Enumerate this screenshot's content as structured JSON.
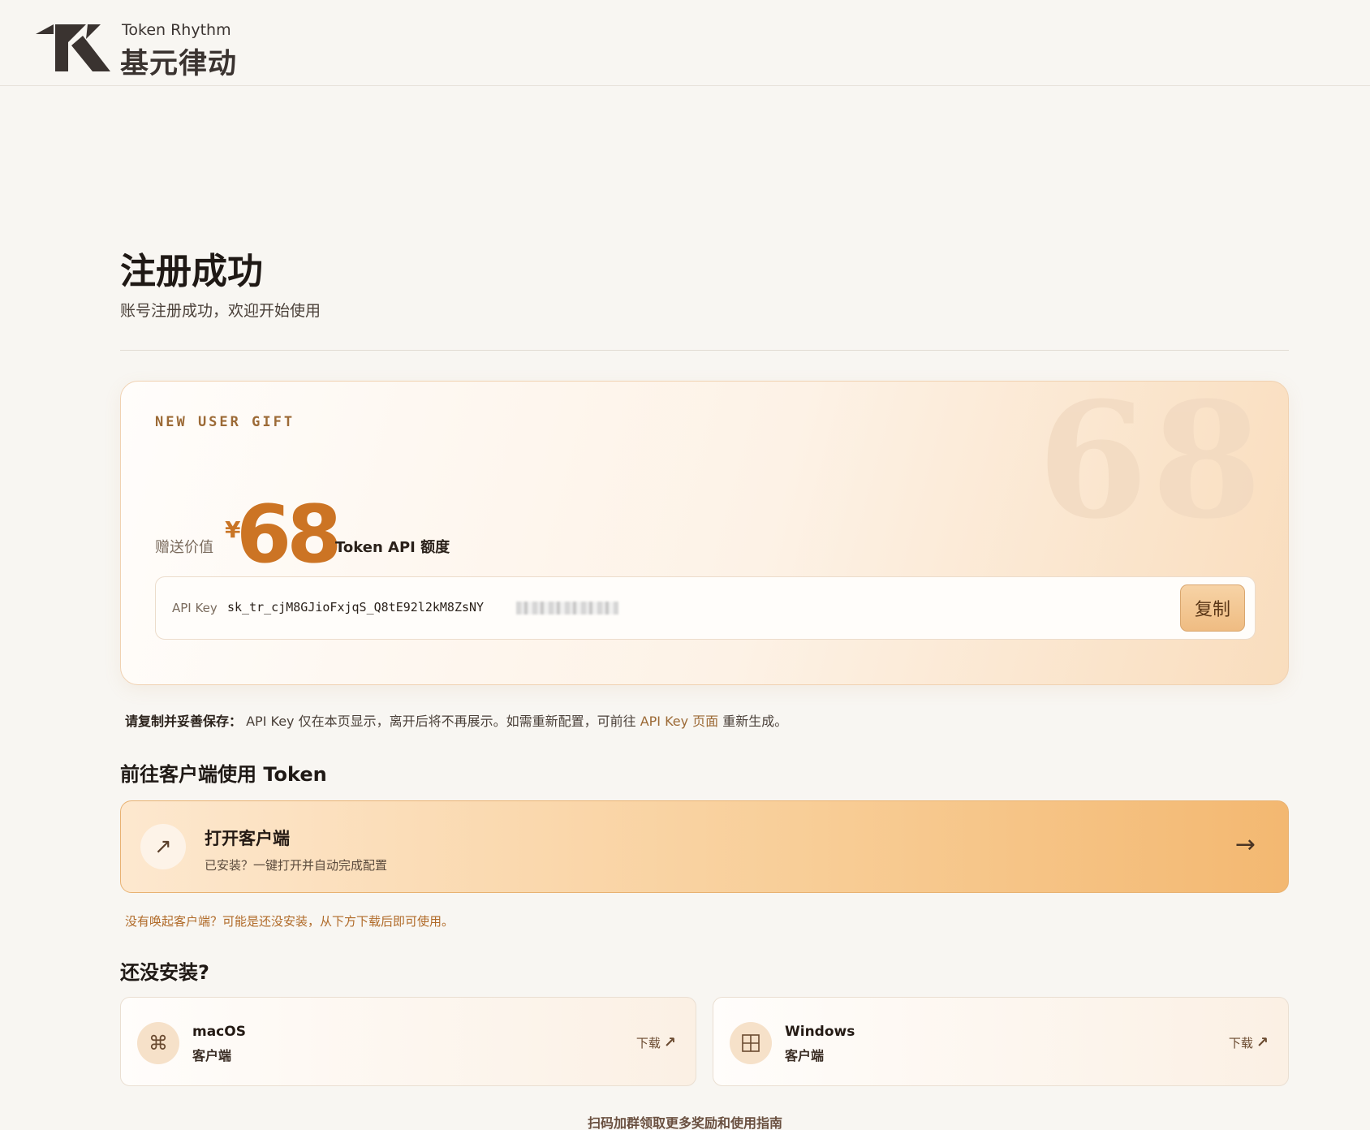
{
  "brand": {
    "name_en": "Token Rhythm",
    "name_cn": "基元律动",
    "logo_icon": "tr-logo-icon",
    "color": "#3a3330"
  },
  "page": {
    "title": "注册成功",
    "subtitle": "账号注册成功，欢迎开始使用"
  },
  "gift": {
    "label": "NEW USER GIFT",
    "watermark": "68",
    "value_label": "赠送价值",
    "currency": "¥",
    "amount": "68",
    "unit": "Token API 额度",
    "accent_color": "#cc7424"
  },
  "apikey": {
    "label": "API Key",
    "value": "sk_tr_cjM8GJioFxjqS_Q8tE92l2kM8ZsNY",
    "copy_label": "复制"
  },
  "save_note": {
    "bold": "请复制并妥善保存：",
    "text_before": " API Key 仅在本页显示，离开后将不再展示。如需重新配置，可前往 ",
    "link": "API Key 页面",
    "text_after": " 重新生成。"
  },
  "client_section": {
    "title": "前往客户端使用 Token",
    "open": {
      "icon": "arrow-up-right-icon",
      "title": "打开客户端",
      "subtitle": "已安装？一键打开并自动完成配置",
      "arrow_icon": "arrow-right-icon"
    },
    "no_launch_hint": "没有唤起客户端？可能是还没安装，从下方下载后即可使用。"
  },
  "install_section": {
    "title": "还没安装?",
    "downloads": [
      {
        "name": "macOS",
        "kind": "客户端",
        "icon": "command-icon",
        "link": "下载"
      },
      {
        "name": "Windows",
        "kind": "客户端",
        "icon": "windows-icon",
        "link": "下载"
      }
    ]
  },
  "footer": {
    "note": "扫码加群领取更多奖励和使用指南"
  }
}
